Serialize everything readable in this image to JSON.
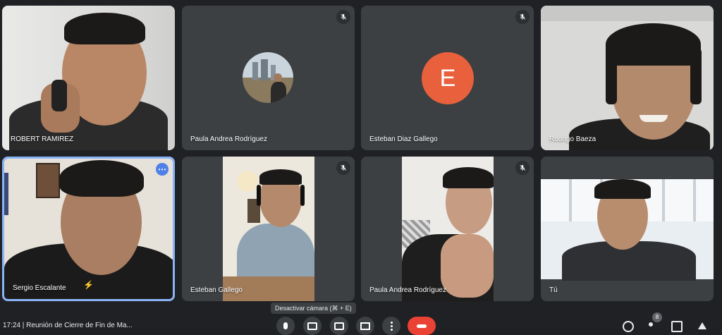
{
  "participants": [
    {
      "name": "ROBERT RAMIREZ",
      "muted": false
    },
    {
      "name": "Paula Andrea Rodríguez",
      "muted": true,
      "avatar": "photo"
    },
    {
      "name": "Esteban Diaz Gallego",
      "muted": true,
      "avatar_letter": "E",
      "avatar_color": "#e8603c"
    },
    {
      "name": "Rodrigo Baeza",
      "muted": false
    },
    {
      "name": "Sergio Escalante",
      "muted": false,
      "active_speaker": true
    },
    {
      "name": "Esteban Gallego",
      "muted": true
    },
    {
      "name": "Paula Andrea Rodríguez",
      "muted": true
    },
    {
      "name": "Tú",
      "muted": false
    }
  ],
  "tooltip": "Desactivar cámara (⌘ + E)",
  "meeting_info": "17:24  |  Reunión de Cierre de Fin de Ma...",
  "people_count": "8",
  "colors": {
    "background": "#202124",
    "tile": "#3c4043",
    "active_border": "#8ab4f8",
    "end_call": "#ea4335"
  }
}
